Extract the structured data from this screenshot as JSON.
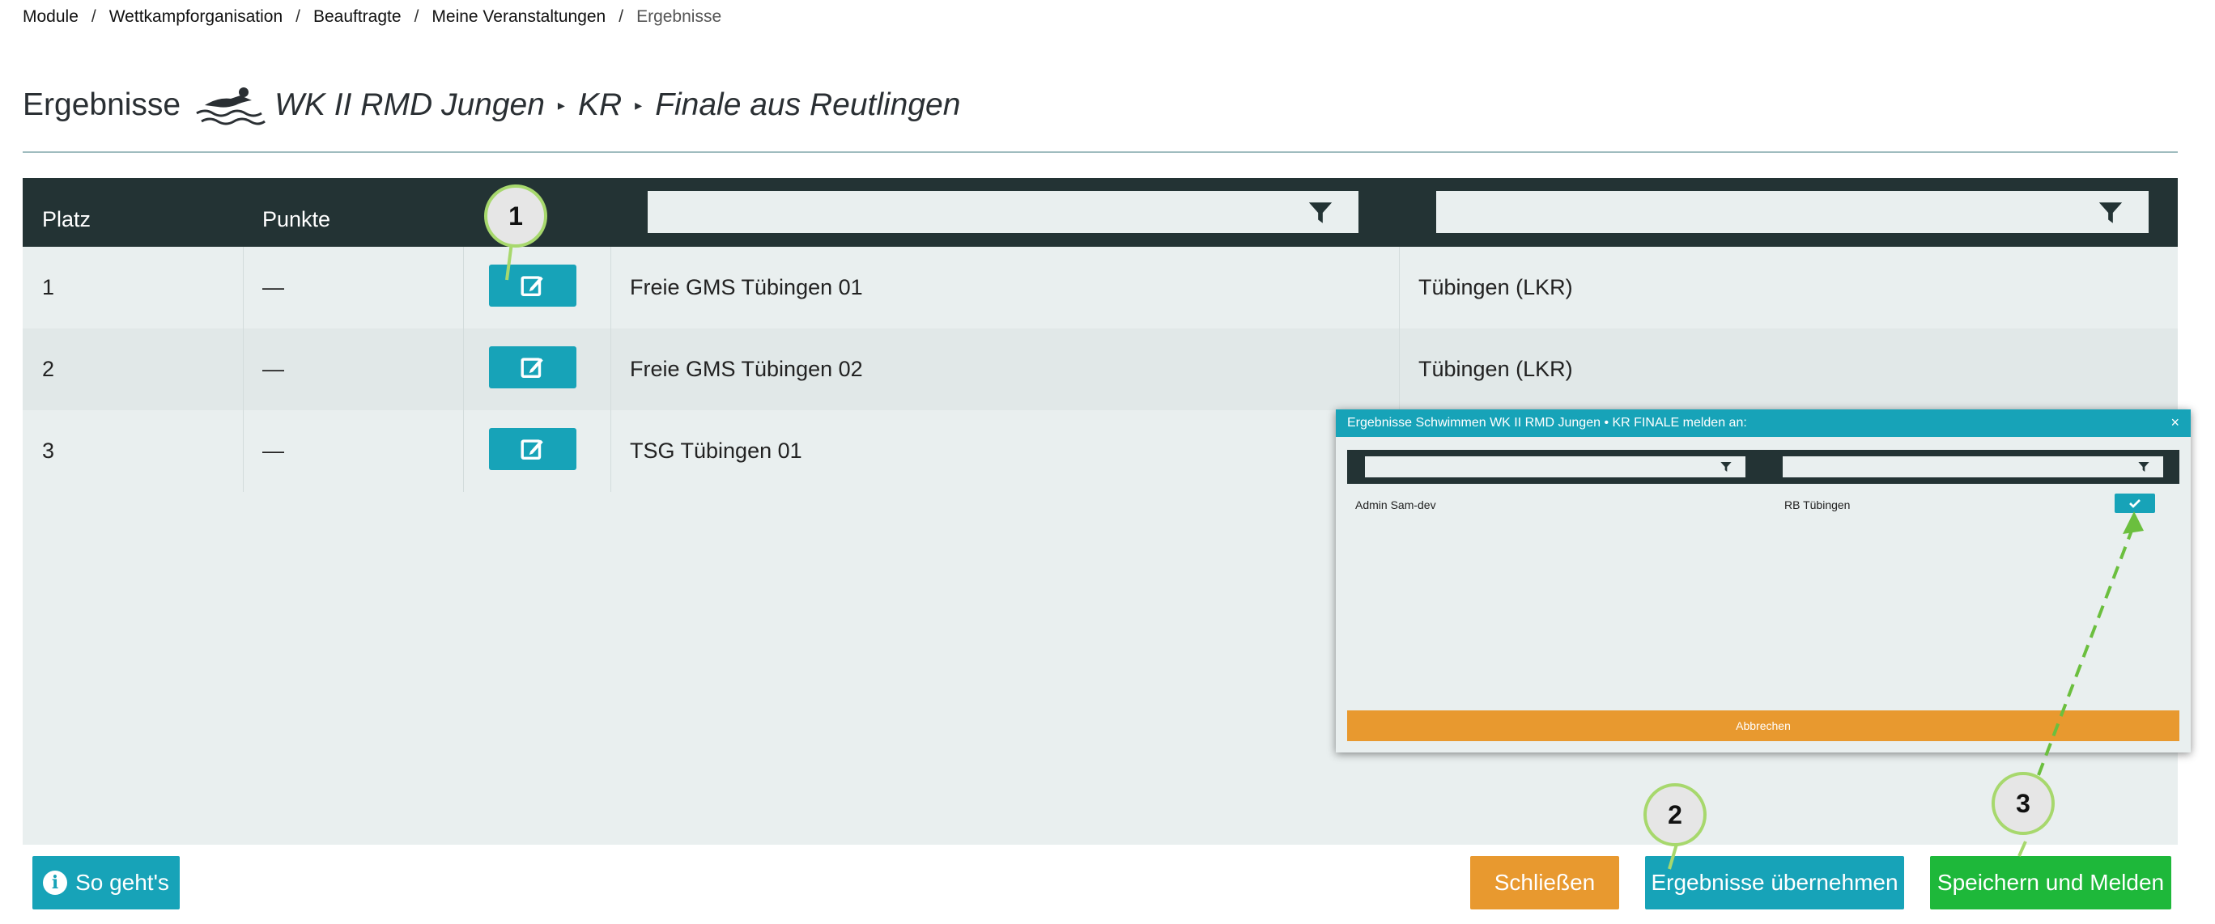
{
  "breadcrumb": {
    "items": [
      "Module",
      "Wettkampforganisation",
      "Beauftragte",
      "Meine Veranstaltungen"
    ],
    "current": "Ergebnisse",
    "separator": "/"
  },
  "header": {
    "title": "Ergebnisse",
    "event": "WK II RMD Jungen",
    "category": "KR",
    "round": "Finale aus Reutlingen",
    "separator": "▸"
  },
  "table": {
    "columns": [
      "Platz",
      "Punkte"
    ],
    "rows": [
      {
        "platz": "1",
        "punkte": "—",
        "team": "Freie GMS Tübingen 01",
        "region": "Tübingen (LKR)"
      },
      {
        "platz": "2",
        "punkte": "—",
        "team": "Freie GMS Tübingen 02",
        "region": "Tübingen (LKR)"
      },
      {
        "platz": "3",
        "punkte": "—",
        "team": "TSG Tübingen 01",
        "region": ""
      }
    ]
  },
  "buttons": {
    "info": "So geht's",
    "close": "Schließen",
    "accept": "Ergebnisse übernehmen",
    "save": "Speichern und Melden"
  },
  "modal": {
    "title": "Ergebnisse Schwimmen WK II RMD Jungen • KR FINALE melden an:",
    "close": "×",
    "row": {
      "name": "Admin Sam-dev",
      "org": "RB Tübingen"
    },
    "cancel": "Abbrechen"
  },
  "callouts": [
    "1",
    "2",
    "3"
  ],
  "colors": {
    "teal": "#17a3b8",
    "dark_header": "#233334",
    "orange": "#e8992f",
    "green": "#1eb83a",
    "panel": "#e9efef",
    "callout_border": "#a7d86d"
  },
  "icons": {
    "edit": "edit-icon",
    "filter": "filter-icon",
    "info": "info-icon",
    "check": "check-icon",
    "swimmer": "swimmer-icon"
  }
}
